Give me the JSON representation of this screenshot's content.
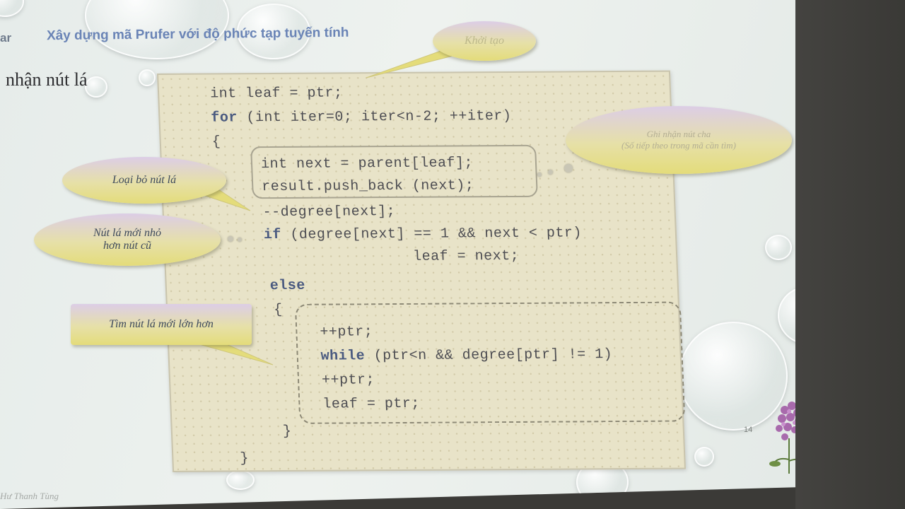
{
  "header": {
    "left_fragment": "ar",
    "title": "Xây dựng mã Prufer với độ phức tạp tuyến tính"
  },
  "side_heading": "nhận nút lá",
  "footer_author": "Hư Thanh Tùng",
  "code_lines": {
    "l1": "int leaf = ptr;",
    "l2": "for (int iter=0; iter<n-2; ++iter)",
    "l3": "{",
    "l4": "int next = parent[leaf];",
    "l5": "result.push_back (next);",
    "l6": "--degree[next];",
    "l7": "if (degree[next] == 1 && next < ptr)",
    "l8": "leaf = next;",
    "l9": "else",
    "l10": "{",
    "l11": "++ptr;",
    "l12": "while (ptr<n && degree[ptr] != 1)",
    "l13": "++ptr;",
    "l14": "leaf = ptr;",
    "l15": "}",
    "l16": "}"
  },
  "callouts": {
    "init": "Khởi tạo",
    "parent_note_1": "Ghi nhận nút cha",
    "parent_note_2": "(Số tiếp theo trong mã cần tìm)",
    "remove_leaf": "Loại bỏ nút lá",
    "new_leaf_smaller_1": "Nút lá mới nhỏ",
    "new_leaf_smaller_2": "hơn nút cũ",
    "find_larger_leaf": "Tìm nút lá mới lớn hơn"
  },
  "slide_number": "14",
  "colors": {
    "title_blue": "#6a84b6",
    "panel_bg": "#e8e3c8",
    "keyword": "#4a5a80",
    "callout_purple": "#dccde6",
    "callout_yellow": "#e4dc7a"
  }
}
